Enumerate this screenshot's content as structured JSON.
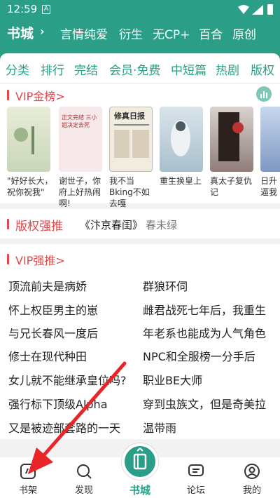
{
  "status": {
    "time": "12:59",
    "app_badge": "A"
  },
  "topnav": {
    "current": "书城",
    "items": [
      "言情",
      "纯爱",
      "衍生",
      "无CP+",
      "百合",
      "原创"
    ]
  },
  "tabs": [
    "分类",
    "排行",
    "完结",
    "会员·免费",
    "中短篇",
    "热剧",
    "版权"
  ],
  "vip_gold": {
    "title": "VIP金榜>",
    "books": [
      {
        "cover_text": "",
        "title": "\"好好长大，祝你祝我\""
      },
      {
        "cover_text": "正文完结 三小姐决定去死",
        "title": "谢世子，你府上好热闹啊!"
      },
      {
        "cover_text": "修真日报",
        "title": "我不当Bking不如去嘎"
      },
      {
        "cover_text": "",
        "title": "重生换皇上"
      },
      {
        "cover_text": "",
        "title": "真太子复仇记"
      },
      {
        "cover_text": "",
        "title": "日升逼我"
      }
    ]
  },
  "copyright": {
    "title": "版权强推",
    "book": "《汴京春闺》",
    "author": "春未绿"
  },
  "vip_push": {
    "title": "VIP强推>",
    "left": [
      "顶流前夫是病娇",
      "怀上权臣男主的崽",
      "与兄长春风一度后",
      "修士在现代种田",
      "女儿就不能继承皇位吗?",
      "强行标下顶级Alpha",
      "又是被迹部套路的一天"
    ],
    "right": [
      "群狼环伺",
      "雌君战死七年后，我重生",
      "年老系也能成为人气角色",
      "NPC和全服榜一分手后",
      "职业BE大师",
      "穿到虫族文，但是奇美拉",
      "温带雨"
    ]
  },
  "bottom": {
    "shelf": "书架",
    "discover": "发现",
    "city": "书城",
    "forum": "论坛",
    "mine": "我的"
  },
  "colors": {
    "primary": "#2a9e86",
    "accent": "#e0484a",
    "pointer": "#e8262a"
  }
}
